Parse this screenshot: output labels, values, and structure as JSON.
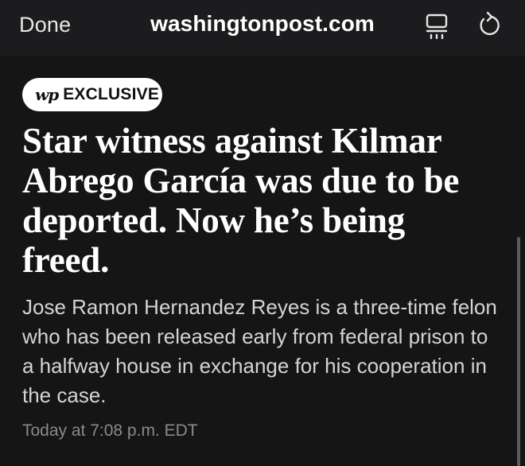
{
  "toolbar": {
    "done_label": "Done",
    "domain": "washingtonpost.com",
    "reader_icon": "reader-mode-icon",
    "refresh_icon": "refresh-icon"
  },
  "article": {
    "badge": {
      "logo": "wp",
      "label": "EXCLUSIVE"
    },
    "headline": "Star witness against Kilmar Abrego García was due to be deported. Now he’s being freed.",
    "dek": "Jose Ramon Hernandez Reyes is a three-time felon who has been released early from federal prison to a halfway house in exchange for his cooperation in the case.",
    "timestamp": "Today at 7:08 p.m. EDT"
  },
  "colors": {
    "background": "#151515",
    "toolbar_background": "#1c1c1e",
    "headline": "#ffffff",
    "dek": "#d4d4d4",
    "timestamp": "#8a8a8a",
    "badge_background": "#ffffff"
  }
}
